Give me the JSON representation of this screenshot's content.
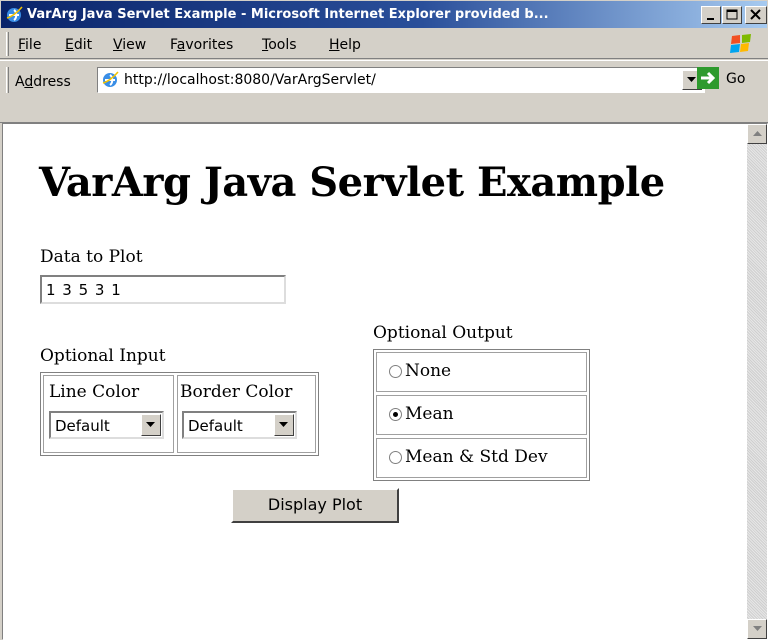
{
  "window": {
    "title": "VarArg Java Servlet Example - Microsoft Internet Explorer provided b...",
    "icons": [
      "ie-icon",
      "minimize-icon",
      "maximize-icon",
      "close-icon"
    ]
  },
  "menu": {
    "items": [
      {
        "mnemonic": "F",
        "rest": "ile"
      },
      {
        "mnemonic": "E",
        "rest": "dit"
      },
      {
        "mnemonic": "V",
        "rest": "iew"
      },
      {
        "pre": "F",
        "mnemonic": "a",
        "rest": "vorites"
      },
      {
        "mnemonic": "T",
        "rest": "ools"
      },
      {
        "mnemonic": "H",
        "rest": "elp"
      }
    ]
  },
  "address_bar": {
    "label_pre": "A",
    "label_mnemonic": "d",
    "label_rest": "dress",
    "url": "http://localhost:8080/VarArgServlet/",
    "go_label": "Go"
  },
  "page": {
    "title": "VarArg Java Servlet Example",
    "data_label": "Data to Plot",
    "data_value": "1 3 5 3 1",
    "optional_input_label": "Optional Input",
    "line_color_label": "Line Color",
    "line_color_value": "Default",
    "border_color_label": "Border Color",
    "border_color_value": "Default",
    "optional_output_label": "Optional Output",
    "output_options": [
      {
        "label": "None",
        "selected": false
      },
      {
        "label": "Mean",
        "selected": true
      },
      {
        "label": "Mean & Std Dev",
        "selected": false
      }
    ],
    "submit_label": "Display Plot"
  }
}
